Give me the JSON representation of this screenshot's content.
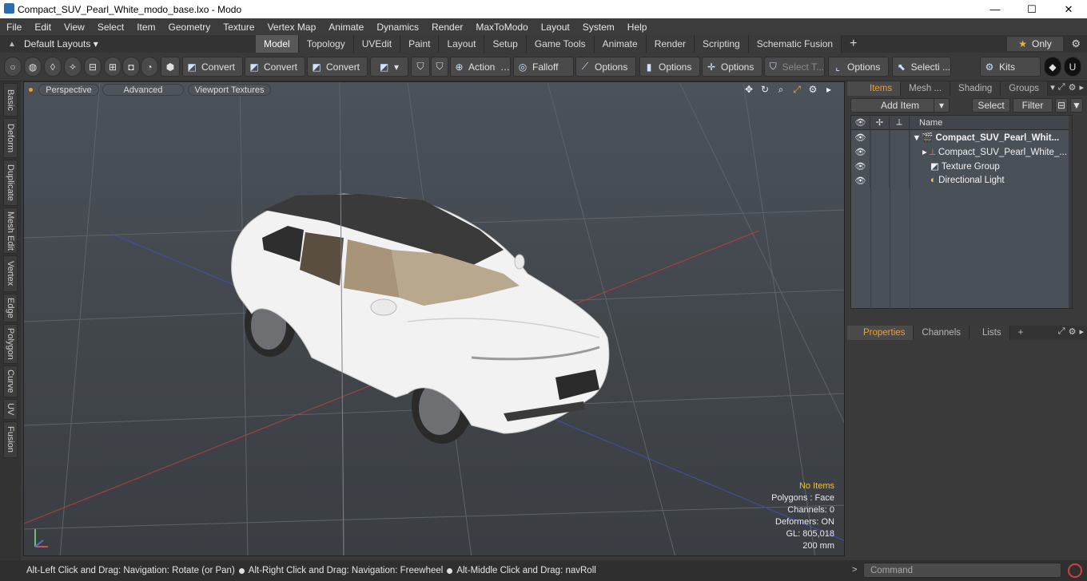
{
  "window": {
    "title": "Compact_SUV_Pearl_White_modo_base.lxo - Modo",
    "minimize": "—",
    "maximize": "☐",
    "close": "✕"
  },
  "menu": [
    "File",
    "Edit",
    "View",
    "Select",
    "Item",
    "Geometry",
    "Texture",
    "Vertex Map",
    "Animate",
    "Dynamics",
    "Render",
    "MaxToModo",
    "Layout",
    "System",
    "Help"
  ],
  "layoutbar": {
    "layout_dropdown": "Default Layouts ▾",
    "tabs": [
      "Model",
      "Topology",
      "UVEdit",
      "Paint",
      "Layout",
      "Setup",
      "Game Tools",
      "Animate",
      "Render",
      "Scripting",
      "Schematic Fusion"
    ],
    "active_tab": "Model",
    "plus": "+",
    "only": "Only",
    "star": "★",
    "gear": "⚙"
  },
  "toolbar": {
    "convert1": "Convert",
    "convert2": "Convert",
    "convert3": "Convert",
    "action": "Action",
    "action_more": "…",
    "falloff": "Falloff",
    "options1": "Options",
    "options2": "Options",
    "options3": "Options",
    "select_t": "Select T...",
    "options4": "Options",
    "selecti": "Selecti ...",
    "kits": "Kits"
  },
  "left_tabs": [
    "Basic",
    "Deform",
    "Duplicate",
    "Mesh Edit",
    "Vertex",
    "Edge",
    "Polygon",
    "Curve",
    "UV",
    "Fusion"
  ],
  "viewport": {
    "perspective": "Perspective",
    "advanced": "Advanced",
    "textures": "Viewport Textures",
    "info": {
      "no_items": "No Items",
      "polygons": "Polygons : Face",
      "channels": "Channels: 0",
      "deformers": "Deformers: ON",
      "gl": "GL: 805,018",
      "scale": "200 mm"
    }
  },
  "status": {
    "left_click": "Alt-Left Click and Drag: Navigation: Rotate (or Pan)",
    "right_click": "Alt-Right Click and Drag: Navigation: Freewheel",
    "middle_click": "Alt-Middle Click and Drag: navRoll"
  },
  "items_panel": {
    "tabs": [
      "Items",
      "Mesh ...",
      "Shading",
      "Groups"
    ],
    "active_tab": "Items",
    "add_item": "Add Item",
    "select": "Select",
    "filter": "Filter",
    "name_header": "Name",
    "rows": [
      {
        "name": "Compact_SUV_Pearl_Whit...",
        "bold": true,
        "indent": 0,
        "icon": "scene-icon"
      },
      {
        "name": "Compact_SUV_Pearl_White_...",
        "bold": false,
        "indent": 1,
        "icon": "mesh-icon"
      },
      {
        "name": "Texture Group",
        "bold": false,
        "indent": 1,
        "icon": "texture-icon"
      },
      {
        "name": "Directional Light",
        "bold": false,
        "indent": 1,
        "icon": "light-icon"
      }
    ]
  },
  "properties_panel": {
    "tabs": [
      "Properties",
      "Channels",
      "Lists"
    ],
    "active_tab": "Properties",
    "plus": "+"
  },
  "command": {
    "placeholder": "Command",
    "arrow": ">"
  },
  "colors": {
    "accent": "#f0a030",
    "viewport_bg": "#454b51",
    "car_body": "#f2f2f2"
  }
}
